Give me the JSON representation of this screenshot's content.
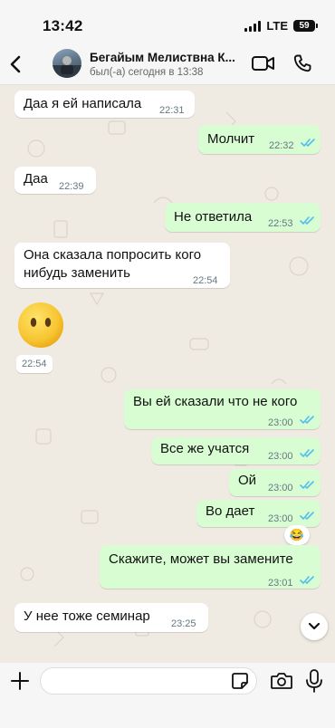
{
  "status_bar": {
    "time": "13:42",
    "network": "LTE",
    "battery": "59"
  },
  "header": {
    "contact_name": "Бегайым  Мелиствна К...",
    "contact_status": "был(-а) сегодня в 13:38"
  },
  "messages": [
    {
      "dir": "in",
      "text": "Даа я ей написала",
      "time": "22:31"
    },
    {
      "dir": "out",
      "text": "Молчит",
      "time": "22:32",
      "read": true
    },
    {
      "dir": "in",
      "text": "Даа",
      "time": "22:39"
    },
    {
      "dir": "out",
      "text": "Не ответила",
      "time": "22:53",
      "read": true
    },
    {
      "dir": "in",
      "text": "Она сказала попросить кого нибудь заменить",
      "time": "22:54"
    },
    {
      "dir": "in",
      "type": "emoji",
      "emoji": "neutral-face-no-mouth",
      "time": "22:54"
    },
    {
      "dir": "out",
      "text": "Вы ей сказали что не кого",
      "time": "23:00",
      "read": true
    },
    {
      "dir": "out",
      "text": "Все же учатся",
      "time": "23:00",
      "read": true
    },
    {
      "dir": "out",
      "text": "Ой",
      "time": "23:00",
      "read": true
    },
    {
      "dir": "out",
      "text": "Во дает",
      "time": "23:00",
      "read": true,
      "reaction": "😂"
    },
    {
      "dir": "out",
      "text": "Скажите, может вы замените",
      "time": "23:01",
      "read": true
    },
    {
      "dir": "in",
      "text": "У нее тоже семинар",
      "time": "23:25"
    }
  ],
  "composer": {
    "placeholder": ""
  },
  "colors": {
    "incoming": "#ffffff",
    "outgoing": "#d9fdd3",
    "ticks": "#53bdeb",
    "chat_bg": "#efeae2"
  },
  "icons": [
    "back-chevron-icon",
    "video-call-icon",
    "phone-icon",
    "plus-icon",
    "sticker-icon",
    "camera-icon",
    "mic-icon",
    "chevron-down-icon",
    "double-check-icon"
  ]
}
